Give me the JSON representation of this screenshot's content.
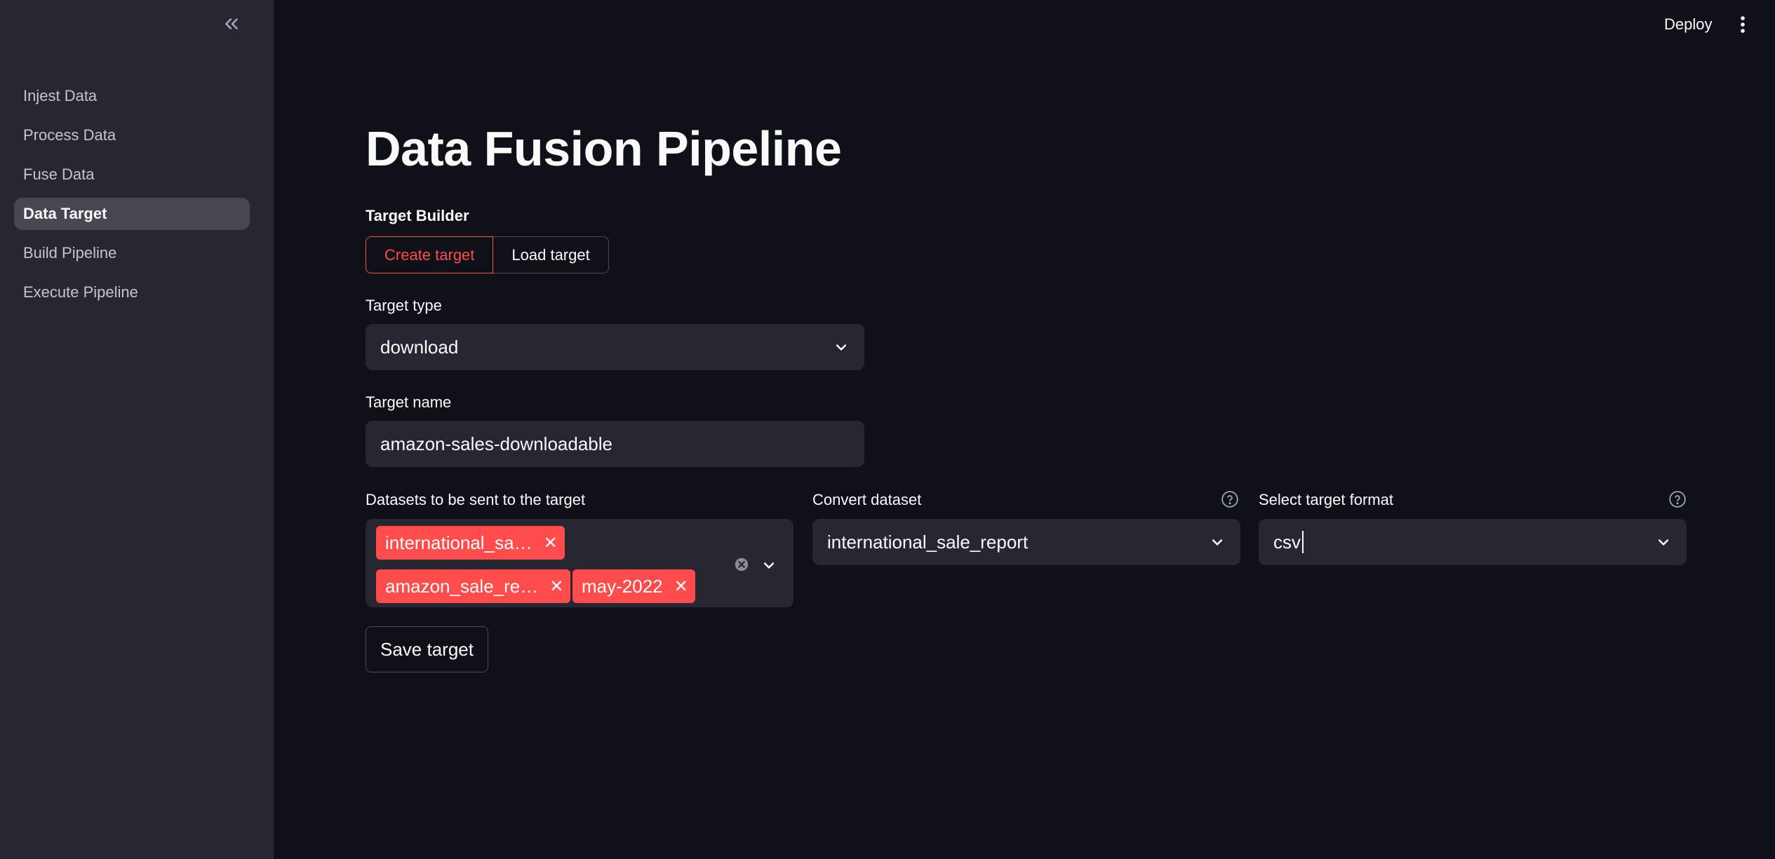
{
  "sidebar": {
    "collapse_icon": "double-chevron-left-icon",
    "items": [
      {
        "label": "Injest Data"
      },
      {
        "label": "Process Data"
      },
      {
        "label": "Fuse Data"
      },
      {
        "label": "Data Target",
        "active": true
      },
      {
        "label": "Build Pipeline"
      },
      {
        "label": "Execute Pipeline"
      }
    ]
  },
  "header": {
    "deploy_label": "Deploy",
    "menu_icon": "kebab-menu-icon"
  },
  "main": {
    "title": "Data Fusion Pipeline",
    "target_builder": {
      "label": "Target Builder",
      "options": [
        "Create target",
        "Load target"
      ],
      "selected": "Create target"
    },
    "target_type": {
      "label": "Target type",
      "value": "download"
    },
    "target_name": {
      "label": "Target name",
      "value": "amazon-sales-downloadable"
    },
    "datasets": {
      "label": "Datasets to be sent to the target",
      "chips": [
        "international_sa…",
        "amazon_sale_re…",
        "may-2022"
      ]
    },
    "convert_dataset": {
      "label": "Convert dataset",
      "value": "international_sale_report"
    },
    "target_format": {
      "label": "Select target format",
      "value": "csv"
    },
    "save_label": "Save target"
  },
  "colors": {
    "background": "#0e1117",
    "sidebar": "#262730",
    "accent": "#ff4b4b",
    "input_bg": "#262730"
  }
}
